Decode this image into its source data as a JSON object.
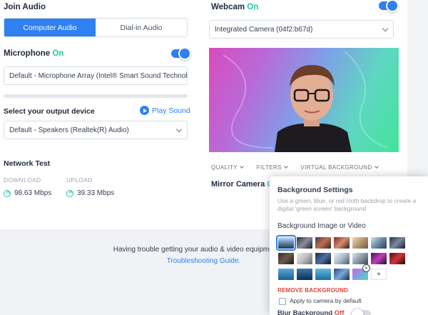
{
  "join_audio": {
    "title": "Join Audio",
    "tabs": [
      {
        "label": "Computer Audio",
        "active": true
      },
      {
        "label": "Dial-in Audio",
        "active": false
      }
    ]
  },
  "microphone": {
    "label": "Microphone",
    "state": "On",
    "enabled": true,
    "device": "Default - Microphone Array (Intel® Smart Sound Technology"
  },
  "output": {
    "label": "Select your output device",
    "play_label": "Play Sound",
    "device": "Default - Speakers (Realtek(R) Audio)"
  },
  "network": {
    "title": "Network Test",
    "download_label": "DOWNLOAD",
    "download_value": "98.63 Mbps",
    "upload_label": "UPLOAD",
    "upload_value": "39.33 Mbps"
  },
  "webcam": {
    "label": "Webcam",
    "state": "On",
    "enabled": true,
    "device": "Integrated Camera (04f2:b67d)",
    "tabs": [
      "QUALITY",
      "FILTERS",
      "VIRTUAL BACKGROUND"
    ],
    "mirror_label": "Mirror Camera",
    "mirror_state": "On"
  },
  "help": {
    "text": "Having trouble getting your audio & video equipment to w",
    "link": "Troubleshooting Guide."
  },
  "background_settings": {
    "title": "Background Settings",
    "description": "Use a green, blue, or red cloth backdrop to create a digital 'green screen' background",
    "section_label": "Background Image or Video",
    "add_label": "+",
    "remove_label": "REMOVE BACKGROUND",
    "apply_label": "Apply to camera by default",
    "apply_checked": false,
    "blur_label": "Blur Background",
    "blur_state": "Off",
    "blur_enabled": false,
    "thumbnail_count": 19,
    "selected_thumbnail": 1
  },
  "colors": {
    "accent": "#2f80f1",
    "on_green": "#23c7a4",
    "off_red": "#e0413a"
  }
}
